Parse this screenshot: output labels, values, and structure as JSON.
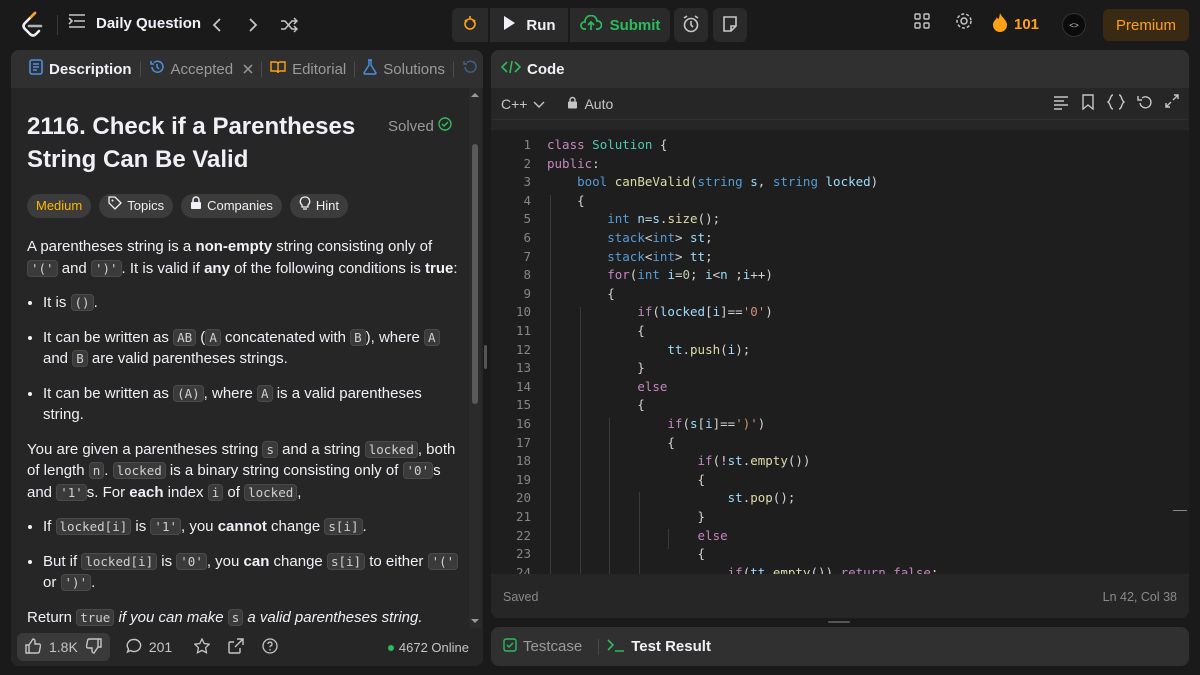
{
  "topbar": {
    "daily_question_label": "Daily Question",
    "run_label": "Run",
    "submit_label": "Submit",
    "streak_count": "101",
    "premium_label": "Premium",
    "avatar_text": "<>"
  },
  "left_tabs": [
    {
      "label": "Description"
    },
    {
      "label": "Accepted"
    },
    {
      "label": "Editorial"
    },
    {
      "label": "Solutions"
    }
  ],
  "problem": {
    "title": "2116. Check if a Parentheses String Can Be Valid",
    "solved_label": "Solved",
    "difficulty": "Medium",
    "chip_topics": "Topics",
    "chip_companies": "Companies",
    "chip_hint": "Hint"
  },
  "description": {
    "p1_a": "A parentheses string is a ",
    "p1_b": "non-empty",
    "p1_c": " string consisting only of ",
    "p1_d": "'('",
    "p1_e": " and ",
    "p1_f": "')'",
    "p1_g": ". It is valid if ",
    "p1_h": "any",
    "p1_i": " of the following conditions is ",
    "p1_j": "true",
    "p1_k": ":",
    "b1_a": "It is ",
    "b1_code": "()",
    "b1_b": ".",
    "b2_a": "It can be written as ",
    "b2_c1": "AB",
    "b2_b": " (",
    "b2_c2": "A",
    "b2_c": " concatenated with ",
    "b2_c3": "B",
    "b2_d": "), where ",
    "b2_c4": "A",
    "b2_e": " and ",
    "b2_c5": "B",
    "b2_f": " are valid parentheses strings.",
    "b3_a": "It can be written as ",
    "b3_c1": "(A)",
    "b3_b": ", where ",
    "b3_c2": "A",
    "b3_c": " is a valid parentheses string.",
    "p2_a": "You are given a parentheses string ",
    "p2_c1": "s",
    "p2_b": " and a string ",
    "p2_c2": "locked",
    "p2_c": ", both of length ",
    "p2_c3": "n",
    "p2_d": ". ",
    "p2_c4": "locked",
    "p2_e": " is a binary string consisting only of ",
    "p2_c5": "'0'",
    "p2_f": "s and ",
    "p2_c6": "'1'",
    "p2_g": "s. For ",
    "p2_h": "each",
    "p2_i": " index ",
    "p2_c7": "i",
    "p2_j": " of ",
    "p2_c8": "locked",
    "p2_k": ",",
    "b4_a": "If ",
    "b4_c1": "locked[i]",
    "b4_b": " is ",
    "b4_c2": "'1'",
    "b4_c": ", you ",
    "b4_d": "cannot",
    "b4_e": " change ",
    "b4_c3": "s[i]",
    "b4_f": ".",
    "b5_a": "But if ",
    "b5_c1": "locked[i]",
    "b5_b": " is ",
    "b5_c2": "'0'",
    "b5_c": ", you ",
    "b5_d": "can",
    "b5_e": " change ",
    "b5_c3": "s[i]",
    "b5_f": " to either ",
    "b5_c4": "'('",
    "b5_g": " or ",
    "b5_c5": "')'",
    "b5_h": ".",
    "p3_a": "Return ",
    "p3_c1": "true",
    "p3_b": " if you can make ",
    "p3_c2": "s",
    "p3_c": " a valid parentheses string."
  },
  "footer": {
    "likes": "1.8K",
    "comments": "201",
    "online": "4672 Online"
  },
  "code_panel": {
    "title": "Code",
    "language": "C++",
    "mode": "Auto",
    "saved": "Saved",
    "cursor": "Ln 42, Col 38"
  },
  "result_tabs": {
    "testcase": "Testcase",
    "test_result": "Test Result"
  },
  "code_lines": [
    "class Solution {",
    "public:",
    "    bool canBeValid(string s, string locked)",
    "    {",
    "        int n=s.size();",
    "        stack<int> st;",
    "        stack<int> tt;",
    "        for(int i=0; i<n ;i++)",
    "        {",
    "            if(locked[i]=='0')",
    "            {",
    "                tt.push(i);",
    "            }",
    "            else",
    "            {",
    "                if(s[i]==')')",
    "                {",
    "                    if(!st.empty())",
    "                    {",
    "                        st.pop();",
    "                    }",
    "                    else",
    "                    {",
    "                        if(tt.empty()) return false;"
  ]
}
